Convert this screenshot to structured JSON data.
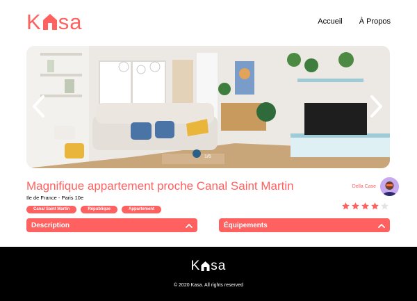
{
  "header": {
    "logo_left": "K",
    "logo_right": "sa",
    "nav": [
      {
        "label": "Accueil"
      },
      {
        "label": "À Propos"
      }
    ]
  },
  "gallery": {
    "counter": "1/6"
  },
  "listing": {
    "title": "Magnifique appartement proche Canal Saint Martin",
    "location": "Ile de France - Paris 10e",
    "tags": [
      "Canal Saint Martin",
      "République",
      "Appartement"
    ],
    "host_name": "Della Case",
    "rating": 4,
    "rating_max": 5
  },
  "collapses": {
    "description": "Description",
    "equipements": "Équipements"
  },
  "footer": {
    "logo_left": "K",
    "logo_right": "sa",
    "copyright": "© 2020 Kasa. All rights reserved"
  },
  "colors": {
    "accent": "#ff6060",
    "star_off": "#e3e3e3",
    "footer_bg": "#000000"
  }
}
